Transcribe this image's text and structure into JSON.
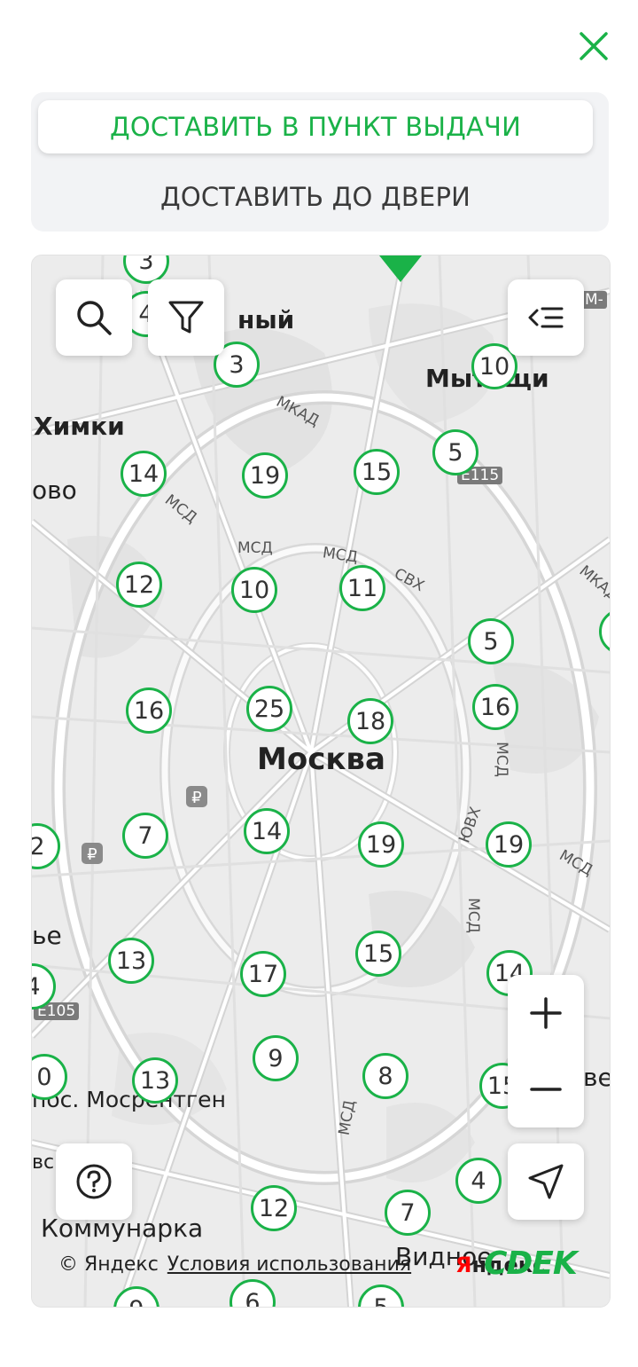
{
  "header": {
    "close_icon": "close-icon"
  },
  "tabs": {
    "pickup_label": "ДОСТАВИТЬ В ПУНКТ ВЫДАЧИ",
    "door_label": "ДОСТАВИТЬ ДО ДВЕРИ"
  },
  "colors": {
    "accent": "#1ab248",
    "map_bg": "#ececec"
  },
  "map": {
    "labels": {
      "city": "Москва",
      "khimki": "Химки",
      "mytishchi": "Мытищи",
      "kommunarka": "Коммунарка",
      "vidnoe": "Видное",
      "mosrentgen": "пос. Мосрентген",
      "nyy": "ный",
      "ovo": "ово",
      "ye": "ье",
      "ves": "ве",
      "vsk": "вск"
    },
    "roads": {
      "mkad1": "МКАД",
      "msd1": "МСД",
      "msd2": "МСД",
      "msd3": "МСД",
      "msd4": "МСД",
      "msd5": "МСД",
      "msd6": "МСД",
      "msd7": "МСД",
      "svh": "СВХ",
      "yuvh": "ЮВХ",
      "mkad2": "МКАД",
      "e115a": "E115",
      "e115b": "E105",
      "m": "M-"
    },
    "clusters": [
      "3",
      "4",
      "3",
      "10",
      "5",
      "14",
      "19",
      "15",
      "5",
      "12",
      "10",
      "11",
      "5",
      "16",
      "25",
      "18",
      "16",
      "7",
      "14",
      "19",
      "19",
      "2",
      "13",
      "17",
      "15",
      "14",
      "4",
      "0",
      "13",
      "9",
      "8",
      "15",
      "12",
      "7",
      "4",
      "9",
      "6",
      "5"
    ],
    "controls": {
      "search": "search-icon",
      "filter": "filter-icon",
      "list": "list-icon",
      "zoom_in": "plus-icon",
      "zoom_out": "minus-icon",
      "locate": "navigation-arrow-icon",
      "help": "question-icon"
    },
    "attribution": {
      "copyright": "© Яндекс",
      "terms": "Условия использования",
      "yandex_logo_red": "Я",
      "yandex_logo_rest": "ндекс",
      "cdek_logo": "CDEK"
    }
  }
}
